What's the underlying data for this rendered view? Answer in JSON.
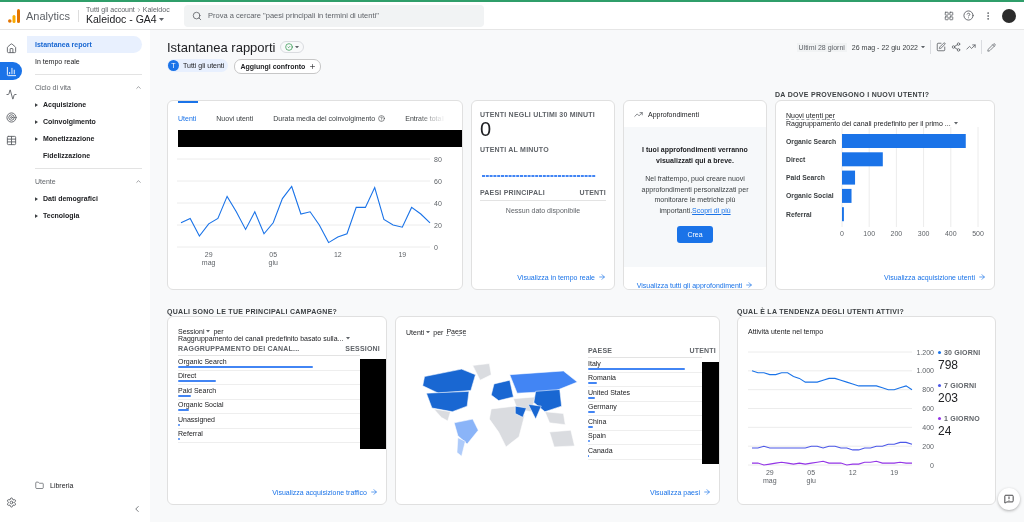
{
  "header": {
    "product": "Analytics",
    "breadcrumb": [
      "Tutti gli account",
      "Kaleidoc"
    ],
    "property": "Kaleidoc - GA4",
    "search": {
      "placeholder": "Prova a cercare \"paesi principali in termini di utenti\""
    }
  },
  "rail": [
    {
      "kind": "home",
      "selected": false
    },
    {
      "kind": "reports",
      "selected": true
    },
    {
      "kind": "explore",
      "selected": false
    },
    {
      "kind": "advertising",
      "selected": false
    },
    {
      "kind": "configure",
      "selected": false
    }
  ],
  "sidebar": {
    "items": [
      {
        "label": "Istantanea report",
        "selected": true
      },
      {
        "label": "In tempo reale",
        "selected": false
      }
    ],
    "sections": [
      {
        "title": "Ciclo di vita",
        "expanded": true,
        "items": [
          {
            "label": "Acquisizione",
            "expandable": true
          },
          {
            "label": "Coinvolgimento",
            "expandable": true
          },
          {
            "label": "Monetizzazione",
            "expandable": true
          },
          {
            "label": "Fidelizzazione",
            "expandable": false
          }
        ]
      },
      {
        "title": "Utente",
        "expanded": true,
        "items": [
          {
            "label": "Dati demografici",
            "expandable": true
          },
          {
            "label": "Tecnologia",
            "expandable": true
          }
        ]
      }
    ],
    "footer": "Libreria"
  },
  "page": {
    "title": "Istantanea rapporti",
    "chips": [
      {
        "kind": "segment",
        "badge": "T",
        "label": "Tutti gli utenti"
      },
      {
        "kind": "add",
        "label": "Aggiungi confronto"
      }
    ],
    "date": {
      "caption": "Ultimi 28 giorni",
      "range": "26 mag - 22 giu 2022"
    }
  },
  "overview": {
    "tabs": [
      {
        "label": "Utenti",
        "selected": true,
        "help": false,
        "cut": false
      },
      {
        "label": "Nuovi utenti",
        "selected": false,
        "help": false,
        "cut": false
      },
      {
        "label": "Durata media del coinvolgimento",
        "selected": false,
        "help": true,
        "cut": false
      },
      {
        "label": "Entrate totali",
        "selected": false,
        "help": false,
        "cut": true
      }
    ],
    "chart_data": {
      "type": "line",
      "categories": [
        null,
        null,
        null,
        "29 mag",
        null,
        null,
        null,
        null,
        null,
        null,
        "05 giu",
        null,
        null,
        null,
        null,
        null,
        null,
        "12",
        null,
        null,
        null,
        null,
        null,
        null,
        "19",
        null,
        null,
        null
      ],
      "series": [
        {
          "values": [
            22,
            26,
            10,
            21,
            26,
            46,
            32,
            16,
            32,
            12,
            22,
            44,
            55,
            30,
            32,
            20,
            4,
            9,
            12,
            36,
            36,
            54,
            25,
            20,
            18,
            36,
            30,
            22
          ]
        }
      ],
      "ylim": [
        0,
        80
      ],
      "yticks": [
        0,
        20,
        40,
        60,
        80
      ],
      "grid": true
    }
  },
  "realtime": {
    "title": "UTENTI NEGLI ULTIMI 30 MINUTI",
    "value": "0",
    "subtitle": "UTENTI AL MINUTO",
    "columns": [
      "PAESI PRINCIPALI",
      "UTENTI"
    ],
    "empty": "Nessun dato disponibile",
    "link": "Visualizza in tempo reale"
  },
  "insights": {
    "title": "Approfondimenti",
    "headline": "I tuoi approfondimenti verranno visualizzati qui a breve.",
    "body": "Nel frattempo, puoi creare nuovi approfondimenti personalizzati per monitorare le metriche più importanti.",
    "learn_more": "Scopri di più",
    "button": "Crea",
    "link": "Visualizza tutti gli approfondimenti"
  },
  "new_users": {
    "section": "DA DOVE PROVENGONO I NUOVI UTENTI?",
    "metric": "Nuovi utenti per",
    "dimension": "Raggruppamento dei canali predefinito per il primo ...",
    "chart_data": {
      "type": "bar",
      "orientation": "horizontal",
      "categories": [
        "Organic Search",
        "Direct",
        "Paid Search",
        "Organic Social",
        "Referral"
      ],
      "values": [
        455,
        150,
        48,
        35,
        7
      ],
      "xlim": [
        0,
        500
      ],
      "xticks": [
        0,
        100,
        200,
        300,
        400,
        500
      ],
      "grid": true
    },
    "link": "Visualizza acquisizione utenti"
  },
  "campaigns": {
    "section": "QUALI SONO LE TUE PRINCIPALI CAMPAGNE?",
    "metric": "Sessioni",
    "per": "per",
    "dimension": "Raggruppamento dei canali predefinito basato sulla...",
    "columns": [
      "RAGGRUPPAMENTO DEI CANAL...",
      "SESSIONI"
    ],
    "rows": [
      {
        "label": "Organic Search",
        "level": 0.74
      },
      {
        "label": "Direct",
        "level": 0.21
      },
      {
        "label": "Paid Search",
        "level": 0.07
      },
      {
        "label": "Organic Social",
        "level": 0.06
      },
      {
        "label": "Unassigned",
        "level": 0.01
      },
      {
        "label": "Referral",
        "level": 0.01
      }
    ],
    "link": "Visualizza acquisizione traffico"
  },
  "countries": {
    "metric": "Utenti",
    "per": "per",
    "dimension": "Paese",
    "columns": [
      "PAESE",
      "UTENTI"
    ],
    "rows": [
      {
        "label": "Italy",
        "level": 0.85
      },
      {
        "label": "Romania",
        "level": 0.08
      },
      {
        "label": "United States",
        "level": 0.06
      },
      {
        "label": "Germany",
        "level": 0.06
      },
      {
        "label": "China",
        "level": 0.04
      },
      {
        "label": "Spain",
        "level": 0.02
      },
      {
        "label": "Canada",
        "level": 0.01
      }
    ],
    "link": "Visualizza paesi"
  },
  "active_users": {
    "section": "QUAL È LA TENDENZA DEGLI UTENTI ATTIVI?",
    "title": "Attività utente nel tempo",
    "chart_data": {
      "type": "line",
      "categories": [
        null,
        null,
        null,
        "29 mag",
        null,
        null,
        null,
        null,
        null,
        null,
        "05 giu",
        null,
        null,
        null,
        null,
        null,
        null,
        "12",
        null,
        null,
        null,
        null,
        null,
        null,
        "19",
        null,
        null,
        null
      ],
      "series": [
        {
          "name": "30 GIORNI",
          "color": "#1a73e8",
          "values": [
            1000,
            980,
            980,
            960,
            960,
            980,
            980,
            940,
            920,
            880,
            880,
            880,
            900,
            920,
            920,
            900,
            880,
            860,
            840,
            840,
            840,
            840,
            820,
            800,
            800,
            820,
            840,
            800
          ]
        },
        {
          "name": "7 GIORNI",
          "color": "#4b57e8",
          "values": [
            180,
            180,
            200,
            180,
            180,
            180,
            180,
            180,
            180,
            180,
            200,
            200,
            180,
            200,
            200,
            180,
            180,
            160,
            160,
            180,
            180,
            200,
            200,
            220,
            220,
            240,
            240,
            220
          ]
        },
        {
          "name": "1 GIORNO",
          "color": "#9334e6",
          "values": [
            20,
            20,
            0,
            10,
            20,
            30,
            20,
            10,
            20,
            10,
            20,
            30,
            40,
            20,
            20,
            20,
            0,
            10,
            10,
            30,
            30,
            40,
            20,
            20,
            20,
            30,
            20,
            20
          ]
        }
      ],
      "ylim": [
        0,
        1200
      ],
      "yticks": [
        0,
        200,
        400,
        600,
        800,
        {
          "value": 1000,
          "label": "1.000"
        },
        {
          "value": 1200,
          "label": "1.200"
        }
      ],
      "grid": true
    },
    "totals": [
      "798",
      "203",
      "24"
    ]
  }
}
